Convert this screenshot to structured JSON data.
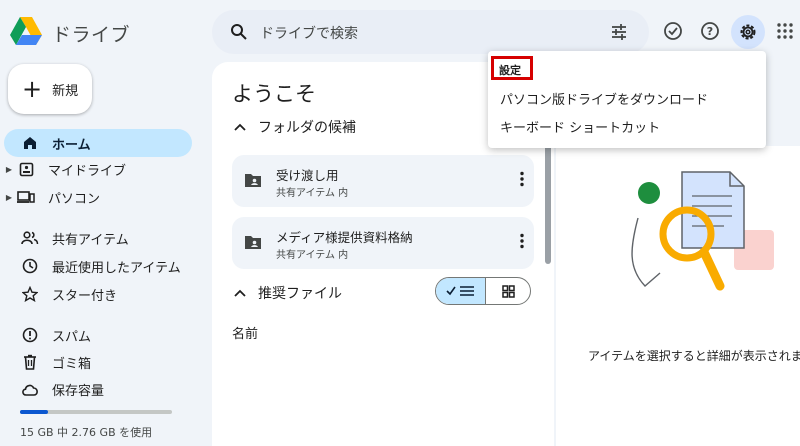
{
  "header": {
    "app_title": "ドライブ",
    "search_placeholder": "ドライブで検索"
  },
  "sidebar": {
    "new_label": "新規",
    "items": [
      {
        "label": "ホーム",
        "icon": "home-icon"
      },
      {
        "label": "マイドライブ",
        "icon": "my-drive-icon"
      },
      {
        "label": "パソコン",
        "icon": "computer-icon"
      },
      {
        "label": "共有アイテム",
        "icon": "people-icon"
      },
      {
        "label": "最近使用したアイテム",
        "icon": "clock-icon"
      },
      {
        "label": "スター付き",
        "icon": "star-icon"
      },
      {
        "label": "スパム",
        "icon": "spam-icon"
      },
      {
        "label": "ゴミ箱",
        "icon": "trash-icon"
      },
      {
        "label": "保存容量",
        "icon": "cloud-icon"
      }
    ],
    "storage_text": "15 GB 中 2.76 GB を使用",
    "storage_fraction": 0.184
  },
  "main": {
    "welcome": "ようこそ",
    "folders_header": "フォルダの候補",
    "folders": [
      {
        "name": "受け渡し用",
        "location": "共有アイテム 内"
      },
      {
        "name": "メディア様提供資料格納",
        "location": "共有アイテム 内"
      }
    ],
    "files_header": "推奨ファイル",
    "column_name": "名前"
  },
  "detail": {
    "empty_text": "アイテムを選択すると詳細が表示されま"
  },
  "settings_menu": {
    "items": [
      "設定",
      "パソコン版ドライブをダウンロード",
      "キーボード ショートカット"
    ]
  },
  "colors": {
    "accent": "#0b57d0",
    "active_bg": "#c2e7ff",
    "highlight_border": "#d60000",
    "page_bg": "#f0f4f9"
  }
}
